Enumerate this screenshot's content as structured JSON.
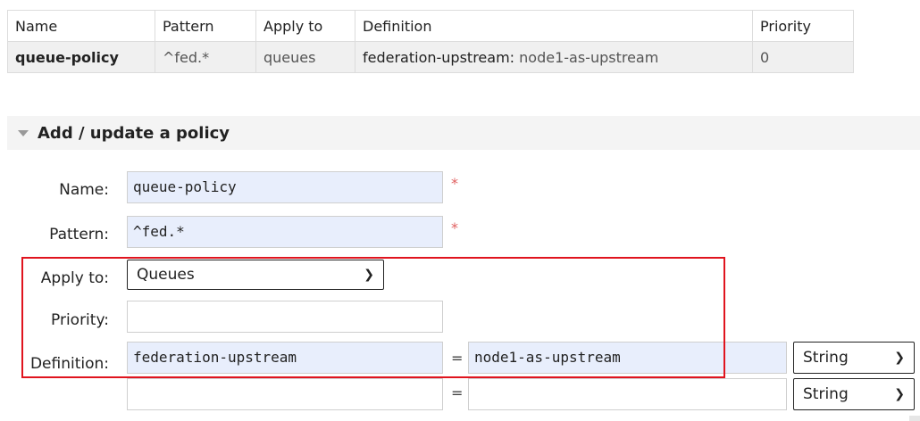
{
  "table": {
    "headers": [
      "Name",
      "Pattern",
      "Apply to",
      "Definition",
      "Priority"
    ],
    "row": {
      "name": "queue-policy",
      "pattern": "^fed.*",
      "apply_to": "queues",
      "definition_key": "federation-upstream:",
      "definition_value": "node1-as-upstream",
      "priority": "0"
    }
  },
  "form": {
    "section_title": "Add / update a policy",
    "name_label": "Name:",
    "name_value": "queue-policy",
    "pattern_label": "Pattern:",
    "pattern_value": "^fed.*",
    "required_mark": "*",
    "apply_to_label": "Apply to:",
    "apply_to_value": "Queues",
    "priority_label": "Priority:",
    "priority_value": "",
    "definition_label": "Definition:",
    "definitions": [
      {
        "key": "federation-upstream",
        "eq": "=",
        "value": "node1-as-upstream",
        "type": "String"
      },
      {
        "key": "",
        "eq": "=",
        "value": "",
        "type": "String"
      }
    ]
  },
  "colors": {
    "highlight_box": "#e0141e",
    "input_fill": "#e8eefc",
    "required": "#e06060"
  }
}
